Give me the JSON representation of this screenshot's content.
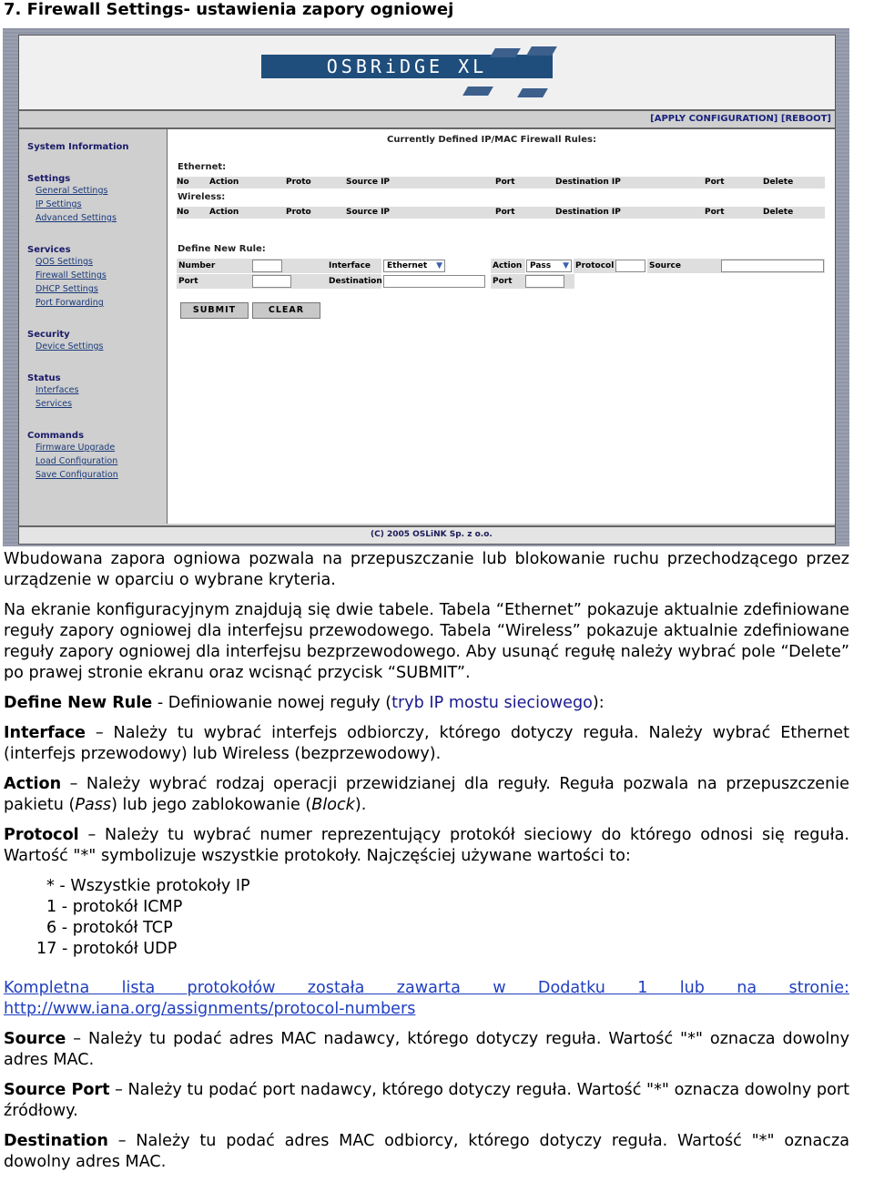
{
  "heading": "7. Firewall Settings- ustawienia zapory ogniowej",
  "screenshot": {
    "logo": "OSBRiDGE XL",
    "top_links": [
      "[APPLY CONFIGURATION]",
      "[REBOOT]"
    ],
    "sidebar": [
      {
        "title": "System Information",
        "links": []
      },
      {
        "title": "Settings",
        "links": [
          "General Settings",
          "IP Settings",
          "Advanced Settings"
        ]
      },
      {
        "title": "Services",
        "links": [
          "QOS Settings",
          "Firewall Settings",
          "DHCP Settings",
          "Port Forwarding"
        ]
      },
      {
        "title": "Security",
        "links": [
          "Device Settings"
        ]
      },
      {
        "title": "Status",
        "links": [
          "Interfaces",
          "Services"
        ]
      },
      {
        "title": "Commands",
        "links": [
          "Firmware Upgrade",
          "Load Configuration",
          "Save Configuration"
        ]
      }
    ],
    "rules_title": "Currently Defined IP/MAC Firewall Rules:",
    "ethernet_label": "Ethernet:",
    "wireless_label": "Wireless:",
    "columns": [
      "No",
      "Action",
      "Proto",
      "Source IP",
      "Port",
      "Destination IP",
      "Port",
      "Delete"
    ],
    "define_title": "Define New Rule:",
    "form": {
      "number": "Number",
      "interface": "Interface",
      "interface_value": "Ethernet",
      "action": "Action",
      "action_value": "Pass",
      "protocol": "Protocol",
      "source": "Source",
      "port": "Port",
      "destination": "Destination",
      "port2": "Port"
    },
    "submit": "SUBMIT",
    "clear": "CLEAR",
    "footer": "(C) 2005 OSLiNK Sp. z o.o."
  },
  "doc": {
    "p1": "Wbudowana zapora ogniowa pozwala na przepuszczanie lub blokowanie ruchu przechodzącego przez urządzenie w oparciu o wybrane kryteria.",
    "p2": "Na ekranie konfiguracyjnym znajdują się dwie tabele. Tabela “Ethernet” pokazuje aktualnie zdefiniowane reguły zapory ogniowej dla interfejsu przewodowego. Tabela “Wireless” pokazuje aktualnie zdefiniowane reguły zapory ogniowej dla interfejsu bezprzewodowego. Aby usunąć regułę należy wybrać pole “Delete” po prawej stronie ekranu oraz wcisnąć przycisk “SUBMIT”.",
    "p3_b": "Define New Rule",
    "p3_a": " - Definiowanie nowej reguły (",
    "p3_link": "tryb IP mostu sieciowego",
    "p3_c": "):",
    "p4_b": "Interface",
    "p4": " – Należy tu wybrać interfejs odbiorczy, którego dotyczy reguła. Należy wybrać Ethernet (interfejs przewodowy) lub Wireless (bezprzewodowy).",
    "p5_b": "Action",
    "p5_a": " – Należy wybrać rodzaj operacji przewidzianej dla reguły. Reguła pozwala na przepuszczenie pakietu (",
    "p5_i1": "Pass",
    "p5_m": ") lub jego zablokowanie (",
    "p5_i2": "Block",
    "p5_c": ").",
    "p6_b": "Protocol",
    "p6": " – Należy tu wybrać numer reprezentujący protokół sieciowy do którego odnosi się reguła. Wartość \"*\" symbolizuje wszystkie protokoły. Najczęściej używane wartości to:",
    "protocols": [
      "* - Wszystkie protokoły IP",
      "1 - protokół ICMP",
      "6 - protokół TCP",
      "17 - protokół UDP"
    ],
    "link_text": "Kompletna lista protokołów została zawarta w Dodatku 1 lub na stronie: http://www.iana.org/assignments/protocol-numbers",
    "p7_b": "Source",
    "p7": " – Należy tu podać adres MAC nadawcy, którego dotyczy reguła. Wartość \"*\" oznacza dowolny adres MAC.",
    "p8_b": "Source Port",
    "p8": " – Należy tu podać port nadawcy, którego dotyczy reguła. Wartość \"*\" oznacza dowolny port źródłowy.",
    "p9_b": "Destination",
    "p9": " – Należy tu podać adres MAC odbiorcy, którego dotyczy reguła. Wartość \"*\" oznacza dowolny adres MAC."
  }
}
